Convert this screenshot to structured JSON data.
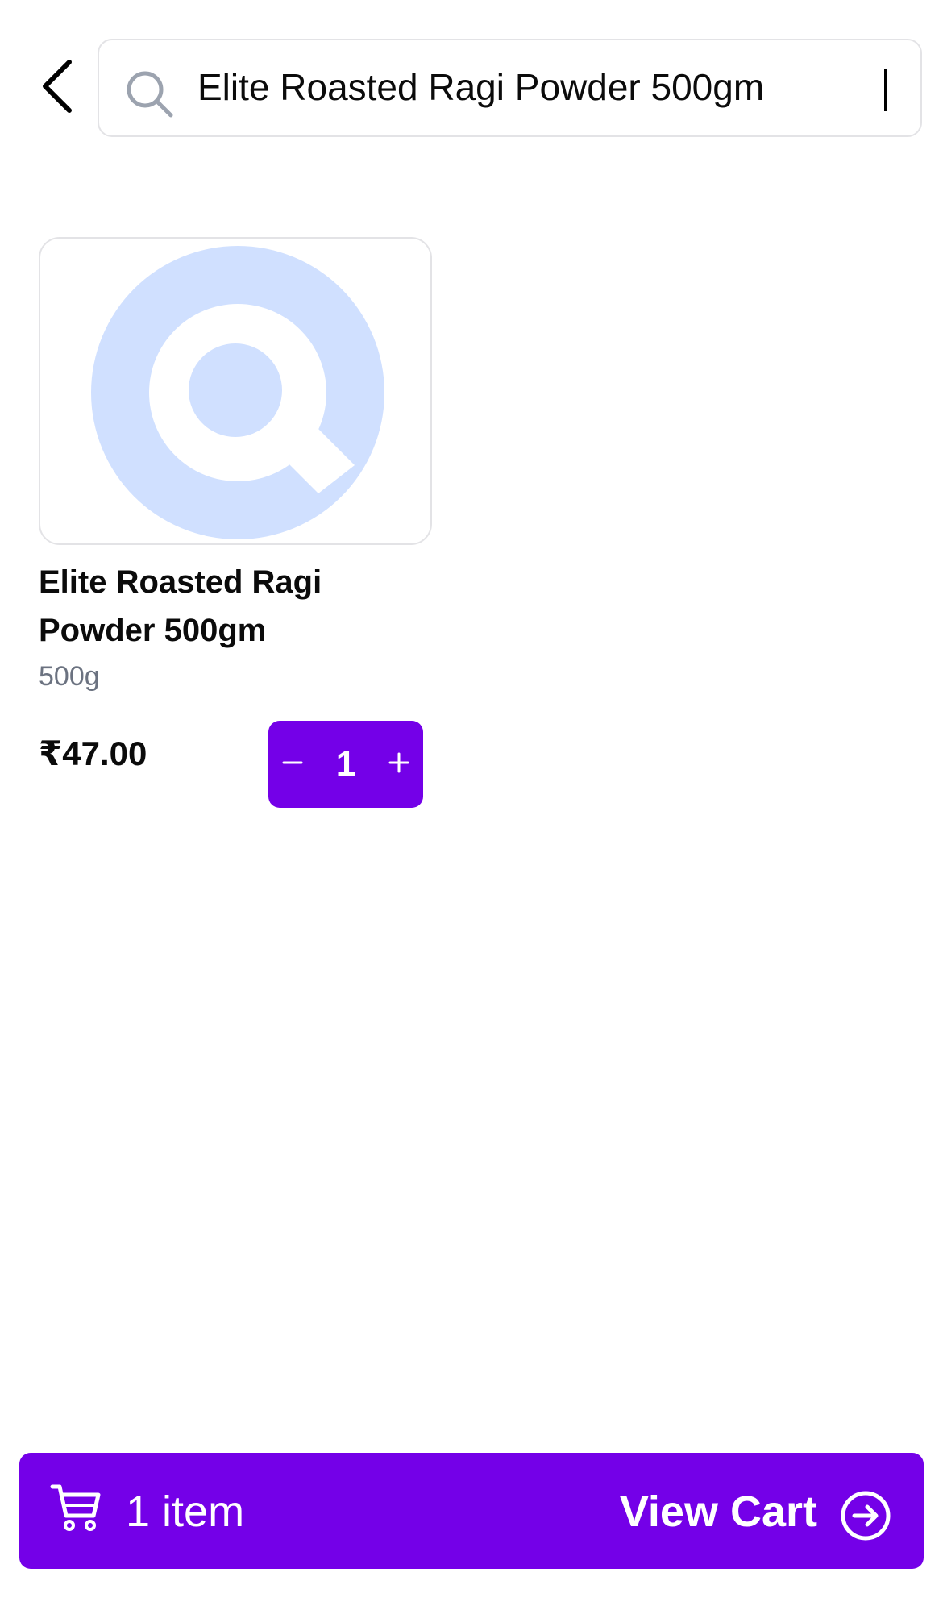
{
  "header": {
    "back_icon": "chevron-left-icon",
    "search": {
      "icon": "search-icon",
      "value": "Elite Roasted Ragi Powder 500gm",
      "placeholder": ""
    }
  },
  "results": [
    {
      "name": "Elite Roasted Ragi Powder 500gm",
      "weight": "500g",
      "price": "₹47.00",
      "quantity": "1",
      "decrement_symbol": "−",
      "increment_symbol": "+",
      "image_placeholder_color": "#d0e0ff"
    }
  ],
  "cart_bar": {
    "icon": "cart-icon",
    "item_count": "1 item",
    "action_label": "View Cart",
    "action_icon": "arrow-right-circle-icon"
  },
  "colors": {
    "accent": "#7400e8",
    "text": "#0b0b0b",
    "muted_text": "#6b7280",
    "border": "#e3e3e6"
  }
}
